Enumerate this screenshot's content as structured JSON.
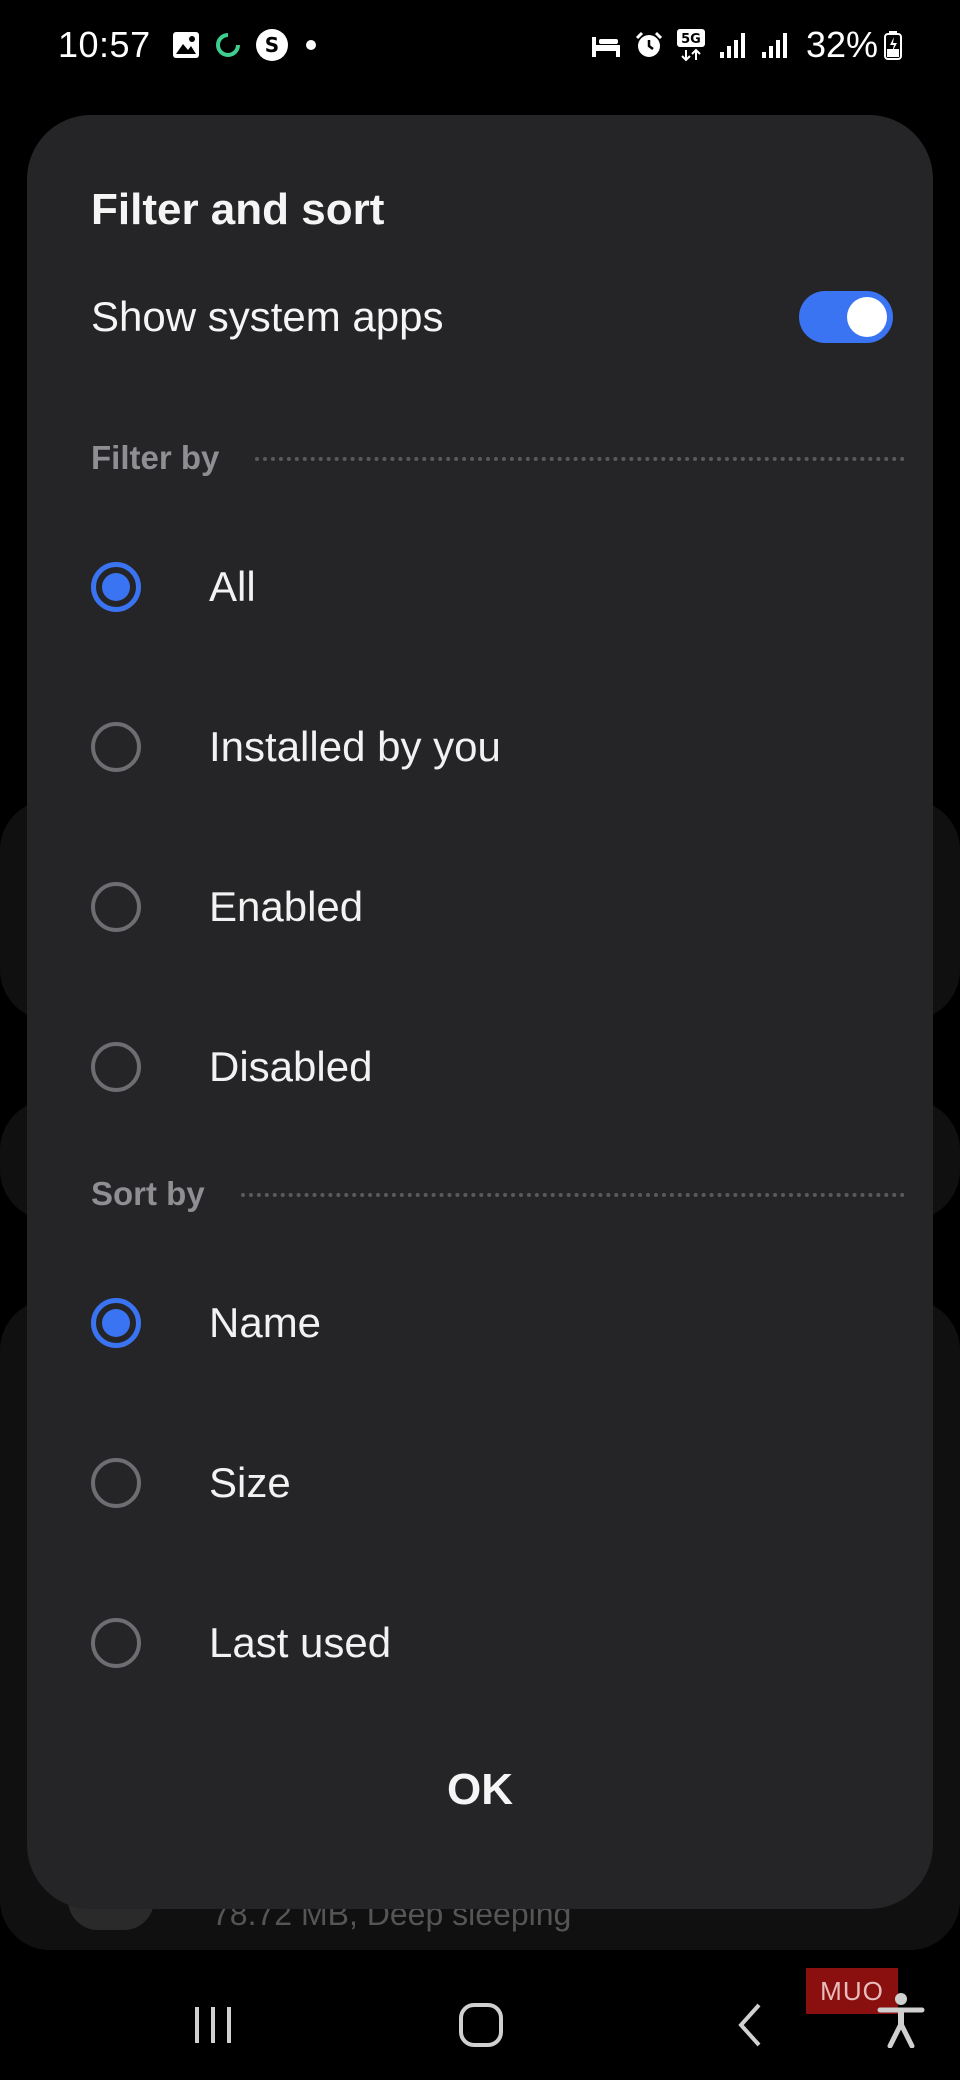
{
  "status_bar": {
    "time": "10:57",
    "battery": "32%",
    "network": "5G",
    "left_icons": [
      "gallery-icon",
      "sync-icon",
      "s-app-icon",
      "dot-icon"
    ],
    "right_icons": [
      "bed-icon",
      "alarm-icon",
      "5g-icon",
      "signal-icon",
      "signal-icon",
      "battery-icon"
    ]
  },
  "dialog": {
    "title": "Filter and sort",
    "toggle": {
      "label": "Show system apps",
      "checked": true
    },
    "filter_by": {
      "label": "Filter by",
      "options": [
        {
          "label": "All",
          "selected": true
        },
        {
          "label": "Installed by you",
          "selected": false
        },
        {
          "label": "Enabled",
          "selected": false
        },
        {
          "label": "Disabled",
          "selected": false
        }
      ]
    },
    "sort_by": {
      "label": "Sort by",
      "options": [
        {
          "label": "Name",
          "selected": true
        },
        {
          "label": "Size",
          "selected": false
        },
        {
          "label": "Last used",
          "selected": false
        }
      ]
    },
    "ok_label": "OK"
  },
  "background": {
    "partial_text": "78.72 MB, Deep sleeping"
  },
  "watermark": "MUO",
  "colors": {
    "accent": "#3a74f2",
    "dialog_bg": "#252527",
    "section_label": "#8e8e93"
  }
}
